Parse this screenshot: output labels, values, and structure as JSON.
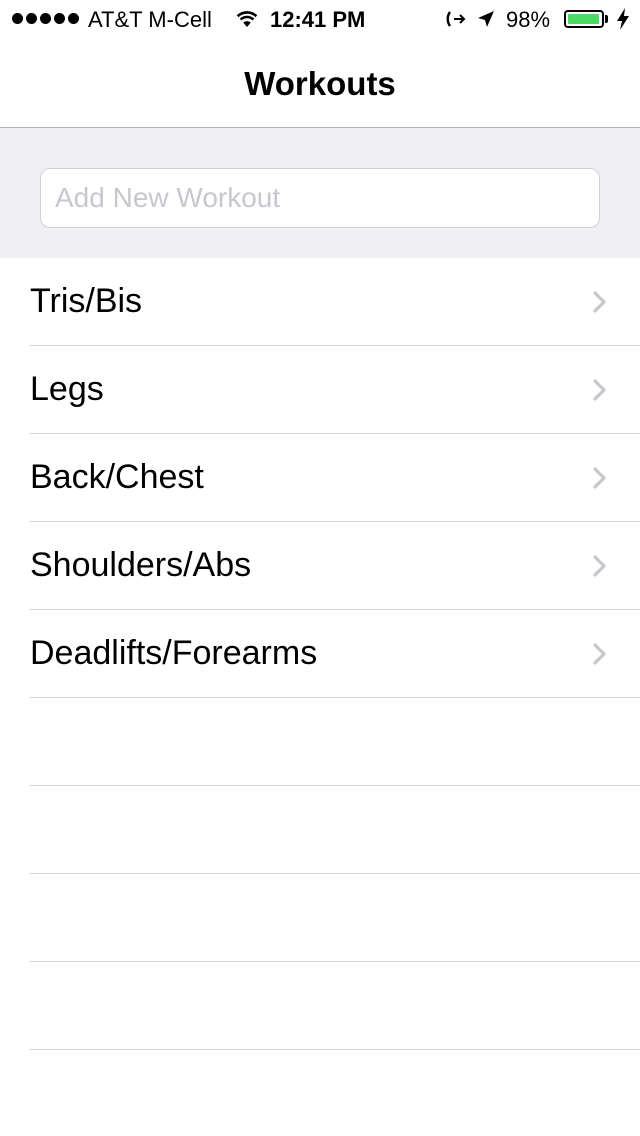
{
  "status_bar": {
    "carrier": "AT&T M-Cell",
    "time": "12:41 PM",
    "battery_percent": "98%",
    "battery_level": 0.98,
    "battery_color": "#4cd964",
    "icons": [
      "signal-dots-icon",
      "wifi-icon",
      "call-forwarding-icon",
      "location-arrow-icon",
      "battery-icon",
      "charging-bolt-icon"
    ]
  },
  "nav": {
    "title": "Workouts"
  },
  "add_workout": {
    "placeholder": "Add New Workout",
    "value": ""
  },
  "workouts": [
    {
      "label": "Tris/Bis"
    },
    {
      "label": "Legs"
    },
    {
      "label": "Back/Chest"
    },
    {
      "label": "Shoulders/Abs"
    },
    {
      "label": "Deadlifts/Forearms"
    }
  ],
  "empty_rows": 4,
  "colors": {
    "group_background": "#efeff4",
    "separator": "#d3d3d6",
    "chevron": "#c7c7cc",
    "placeholder": "#c7c7cd"
  }
}
